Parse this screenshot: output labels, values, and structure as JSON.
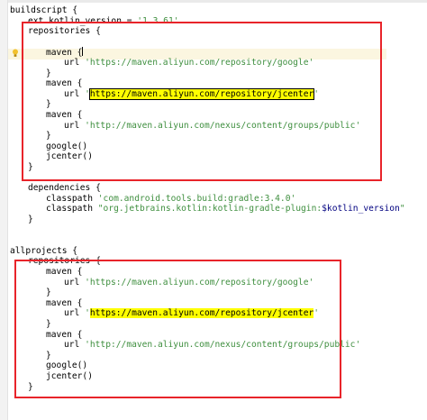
{
  "editor": {
    "lines": [
      {
        "id": "buildscript-open",
        "indent": 0,
        "parts": [
          {
            "t": "buildscript {",
            "c": "kw"
          }
        ]
      },
      {
        "id": "ext-kotlin-version",
        "indent": 1,
        "parts": [
          {
            "t": "ext.kotlin_version = ",
            "c": "kw"
          },
          {
            "t": "'1.3.61'",
            "c": "strg"
          }
        ]
      },
      {
        "id": "repositories-open-1",
        "indent": 1,
        "parts": [
          {
            "t": "repositories {",
            "c": "kw"
          }
        ]
      },
      {
        "id": "blank-1",
        "indent": 0,
        "parts": [
          {
            "t": "",
            "c": "kw"
          }
        ]
      },
      {
        "id": "maven-1",
        "indent": 2,
        "parts": [
          {
            "t": "maven {",
            "c": "kw"
          }
        ]
      },
      {
        "id": "url-1",
        "indent": 3,
        "parts": [
          {
            "t": "url ",
            "c": "kw"
          },
          {
            "t": "'https://maven.aliyun.com/repository/google'",
            "c": "strg"
          }
        ]
      },
      {
        "id": "close-maven-1",
        "indent": 2,
        "parts": [
          {
            "t": "}",
            "c": "kw"
          }
        ]
      },
      {
        "id": "maven-2",
        "indent": 2,
        "parts": [
          {
            "t": "maven {",
            "c": "kw"
          }
        ]
      },
      {
        "id": "url-2",
        "indent": 3,
        "parts": [
          {
            "t": "url ",
            "c": "kw"
          },
          {
            "t": "'",
            "c": "strg"
          },
          {
            "t": "https://maven.aliyun.com/repository/jcenter",
            "c": "hl-boxed"
          },
          {
            "t": "'",
            "c": "strg"
          }
        ]
      },
      {
        "id": "close-maven-2",
        "indent": 2,
        "parts": [
          {
            "t": "}",
            "c": "kw"
          }
        ]
      },
      {
        "id": "maven-3",
        "indent": 2,
        "parts": [
          {
            "t": "maven {",
            "c": "kw"
          }
        ]
      },
      {
        "id": "url-3",
        "indent": 3,
        "parts": [
          {
            "t": "url ",
            "c": "kw"
          },
          {
            "t": "'http://maven.aliyun.com/nexus/content/groups/public'",
            "c": "strg"
          }
        ]
      },
      {
        "id": "close-maven-3",
        "indent": 2,
        "parts": [
          {
            "t": "}",
            "c": "kw"
          }
        ]
      },
      {
        "id": "google-1",
        "indent": 2,
        "parts": [
          {
            "t": "google()",
            "c": "kw"
          }
        ]
      },
      {
        "id": "jcenter-1",
        "indent": 2,
        "parts": [
          {
            "t": "jcenter()",
            "c": "kw"
          }
        ]
      },
      {
        "id": "close-repositories-1",
        "indent": 1,
        "parts": [
          {
            "t": "}",
            "c": "kw"
          }
        ]
      },
      {
        "id": "blank-2",
        "indent": 0,
        "parts": [
          {
            "t": "",
            "c": "kw"
          }
        ]
      },
      {
        "id": "dependencies-open",
        "indent": 1,
        "parts": [
          {
            "t": "dependencies {",
            "c": "kw"
          }
        ]
      },
      {
        "id": "classpath-1",
        "indent": 2,
        "parts": [
          {
            "t": "classpath ",
            "c": "kw"
          },
          {
            "t": "'com.android.tools.build:gradle:3.4.0'",
            "c": "strg"
          }
        ]
      },
      {
        "id": "classpath-2",
        "indent": 2,
        "parts": [
          {
            "t": "classpath ",
            "c": "kw"
          },
          {
            "t": "\"org.jetbrains.kotlin:kotlin-gradle-plugin:",
            "c": "strg"
          },
          {
            "t": "$kotlin_version",
            "c": "var"
          },
          {
            "t": "\"",
            "c": "strg"
          }
        ]
      },
      {
        "id": "close-dependencies",
        "indent": 1,
        "parts": [
          {
            "t": "}",
            "c": "kw"
          }
        ]
      },
      {
        "id": "blank-3",
        "indent": 0,
        "parts": [
          {
            "t": "",
            "c": "kw"
          }
        ]
      },
      {
        "id": "blank-4",
        "indent": 0,
        "parts": [
          {
            "t": "",
            "c": "kw"
          }
        ]
      },
      {
        "id": "allprojects-open",
        "indent": 0,
        "parts": [
          {
            "t": "allprojects {",
            "c": "kw"
          }
        ]
      },
      {
        "id": "repositories-open-2",
        "indent": 1,
        "parts": [
          {
            "t": "repositories {",
            "c": "kw"
          }
        ]
      },
      {
        "id": "maven-4",
        "indent": 2,
        "parts": [
          {
            "t": "maven {",
            "c": "kw"
          }
        ]
      },
      {
        "id": "url-4",
        "indent": 3,
        "parts": [
          {
            "t": "url ",
            "c": "kw"
          },
          {
            "t": "'https://maven.aliyun.com/repository/google'",
            "c": "strg"
          }
        ]
      },
      {
        "id": "close-maven-4",
        "indent": 2,
        "parts": [
          {
            "t": "}",
            "c": "kw"
          }
        ]
      },
      {
        "id": "maven-5",
        "indent": 2,
        "parts": [
          {
            "t": "maven {",
            "c": "kw"
          }
        ]
      },
      {
        "id": "url-5",
        "indent": 3,
        "parts": [
          {
            "t": "url ",
            "c": "kw"
          },
          {
            "t": "'",
            "c": "strg"
          },
          {
            "t": "https://maven.aliyun.com/repository/jcenter",
            "c": "hl-yellow"
          },
          {
            "t": "'",
            "c": "strg"
          }
        ]
      },
      {
        "id": "close-maven-5",
        "indent": 2,
        "parts": [
          {
            "t": "}",
            "c": "kw"
          }
        ]
      },
      {
        "id": "maven-6",
        "indent": 2,
        "parts": [
          {
            "t": "maven {",
            "c": "kw"
          }
        ]
      },
      {
        "id": "url-6",
        "indent": 3,
        "parts": [
          {
            "t": "url ",
            "c": "kw"
          },
          {
            "t": "'http://maven.aliyun.com/nexus/content/groups/public'",
            "c": "strg"
          }
        ]
      },
      {
        "id": "close-maven-6",
        "indent": 2,
        "parts": [
          {
            "t": "}",
            "c": "kw"
          }
        ]
      },
      {
        "id": "google-2",
        "indent": 2,
        "parts": [
          {
            "t": "google()",
            "c": "kw"
          }
        ]
      },
      {
        "id": "jcenter-2",
        "indent": 2,
        "parts": [
          {
            "t": "jcenter()",
            "c": "kw"
          }
        ]
      },
      {
        "id": "close-repositories-2",
        "indent": 1,
        "parts": [
          {
            "t": "}",
            "c": "kw"
          }
        ]
      }
    ]
  },
  "colors": {
    "annotation_box": "#e8242a",
    "search_highlight": "#ffff00",
    "string": "#3f8f3f",
    "variable": "#000080",
    "caret_line": "#fbf6e0"
  }
}
